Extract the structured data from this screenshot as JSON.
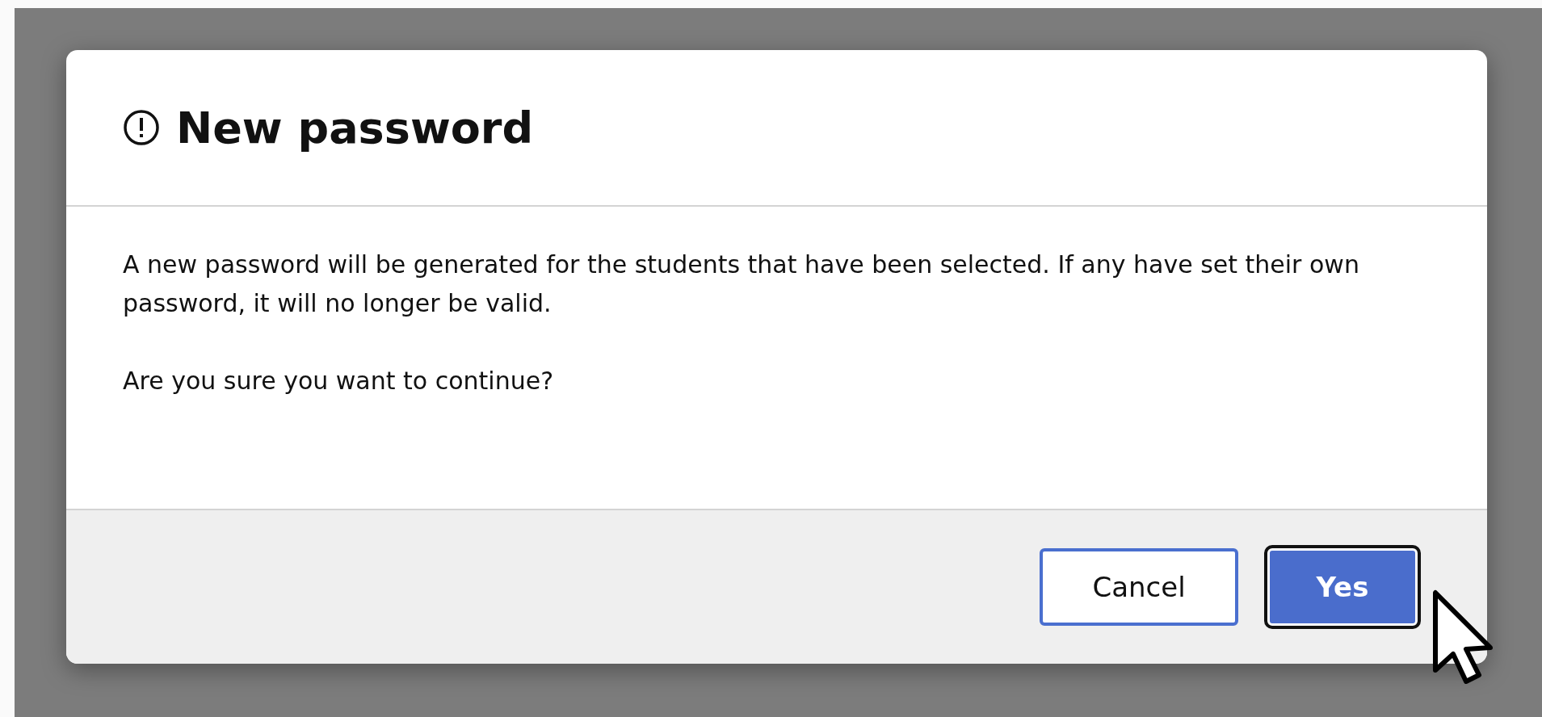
{
  "dialog": {
    "title": "New password",
    "paragraphs": [
      "A new password will be generated for the students that have been selected. If any have set their own password, it will no longer be valid.",
      "Are you sure you want to continue?"
    ],
    "buttons": [
      {
        "label": "Cancel",
        "kind": "secondary"
      },
      {
        "label": "Yes",
        "kind": "primary"
      }
    ]
  }
}
